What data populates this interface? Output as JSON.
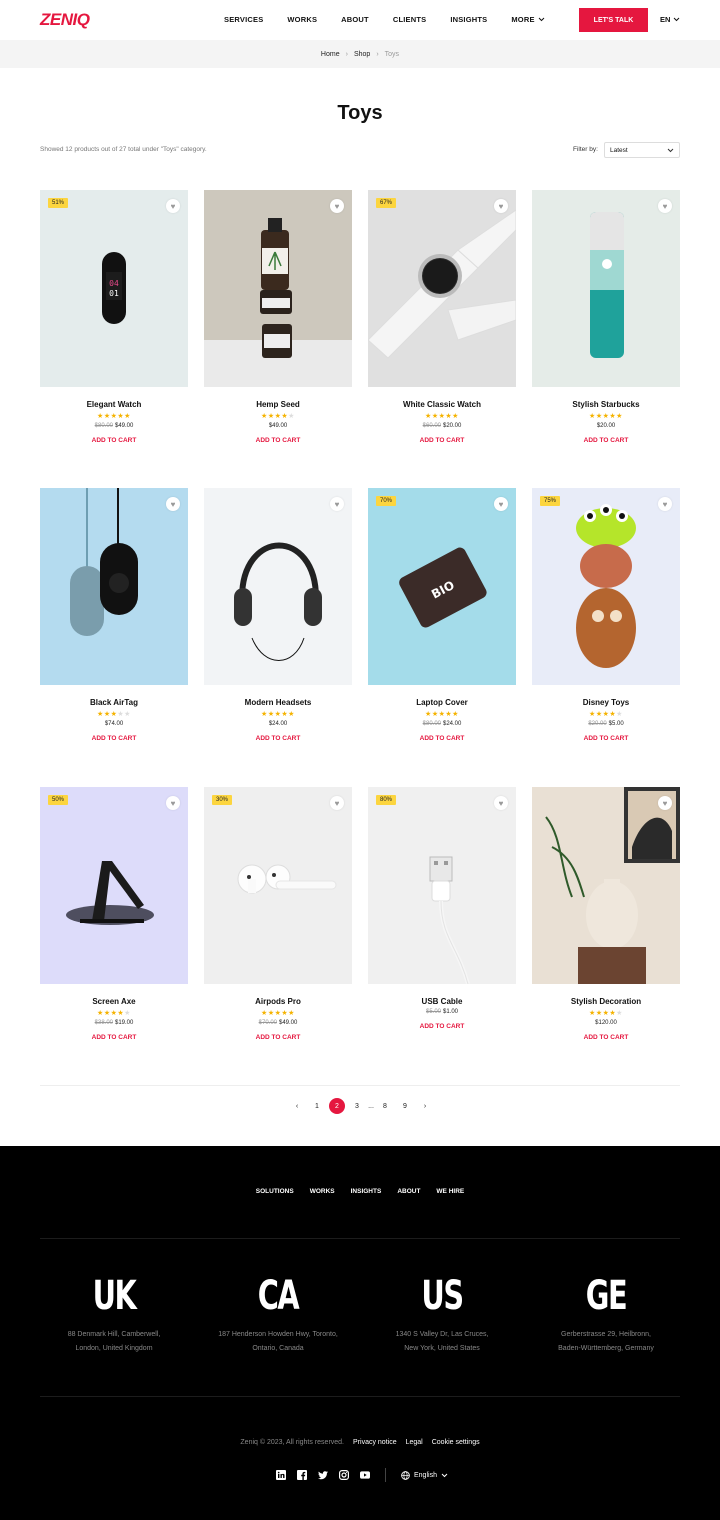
{
  "header": {
    "logo": "ZENIQ",
    "nav": [
      "SERVICES",
      "WORKS",
      "ABOUT",
      "CLIENTS",
      "INSIGHTS"
    ],
    "more": "MORE",
    "cta": "LET'S TALK",
    "lang": "EN"
  },
  "breadcrumb": [
    "Home",
    "Shop",
    "Toys"
  ],
  "page": {
    "title": "Toys",
    "result_text": "Showed 12 products out of 27 total under \"Toys\" category.",
    "filter_label": "Filter by:",
    "filter_value": "Latest"
  },
  "products": [
    {
      "name": "Elegant Watch",
      "rating": 5,
      "old_price": "$80.00",
      "price": "$49.00",
      "badge": "51%",
      "add": "ADD TO CART",
      "bg": "#e4ecec"
    },
    {
      "name": "Hemp Seed",
      "rating": 4,
      "old_price": "",
      "price": "$49.00",
      "badge": "",
      "add": "ADD TO CART",
      "bg": "#cdc8bd"
    },
    {
      "name": "White Classic Watch",
      "rating": 5,
      "old_price": "$60.00",
      "price": "$20.00",
      "badge": "67%",
      "add": "ADD TO CART",
      "bg": "#e0e0e0"
    },
    {
      "name": "Stylish Starbucks",
      "rating": 5,
      "old_price": "",
      "price": "$20.00",
      "badge": "",
      "add": "ADD TO CART",
      "bg": "#e5ece8"
    },
    {
      "name": "Black AirTag",
      "rating": 3,
      "old_price": "",
      "price": "$74.00",
      "badge": "",
      "add": "ADD TO CART",
      "bg": "#b4dbef"
    },
    {
      "name": "Modern Headsets",
      "rating": 5,
      "old_price": "",
      "price": "$24.00",
      "badge": "",
      "add": "ADD TO CART",
      "bg": "#f2f4f6"
    },
    {
      "name": "Laptop Cover",
      "rating": 5,
      "old_price": "$80.00",
      "price": "$24.00",
      "badge": "70%",
      "add": "ADD TO CART",
      "bg": "#a4dcea"
    },
    {
      "name": "Disney Toys",
      "rating": 4,
      "old_price": "$20.00",
      "price": "$5.00",
      "badge": "75%",
      "add": "ADD TO CART",
      "bg": "#e8ecf8"
    },
    {
      "name": "Screen Axe",
      "rating": 4,
      "old_price": "$38.00",
      "price": "$19.00",
      "badge": "50%",
      "add": "ADD TO CART",
      "bg": "#dddcfa"
    },
    {
      "name": "Airpods Pro",
      "rating": 5,
      "old_price": "$70.00",
      "price": "$49.00",
      "badge": "30%",
      "add": "ADD TO CART",
      "bg": "#efefef"
    },
    {
      "name": "USB Cable",
      "rating": 0,
      "old_price": "$5.00",
      "price": "$1.00",
      "badge": "80%",
      "add": "ADD TO CART",
      "bg": "#f0f0f0"
    },
    {
      "name": "Stylish Decoration",
      "rating": 4,
      "old_price": "",
      "price": "$120.00",
      "badge": "",
      "add": "ADD TO CART",
      "bg": "#e9e0d4"
    }
  ],
  "pagination": {
    "pages": [
      "1",
      "2",
      "3",
      "...",
      "8",
      "9"
    ],
    "active": "2"
  },
  "footer": {
    "nav": [
      "SOLUTIONS",
      "WORKS",
      "INSIGHTS",
      "ABOUT",
      "WE HIRE"
    ],
    "offices": [
      {
        "code": "UK",
        "line1": "88 Denmark Hill, Camberwell,",
        "line2": "London, United Kingdom"
      },
      {
        "code": "CA",
        "line1": "187 Henderson Howden Hwy, Toronto,",
        "line2": "Ontario, Canada"
      },
      {
        "code": "US",
        "line1": "1340 S Valley Dr, Las Cruces,",
        "line2": "New York, United States"
      },
      {
        "code": "GE",
        "line1": "Gerberstrasse 29, Heilbronn,",
        "line2": "Baden-Württemberg, Germany"
      }
    ],
    "copyright": "Zeniq © 2023, All rights reserved.",
    "links": [
      "Privacy notice",
      "Legal",
      "Cookie settings"
    ],
    "lang": "English",
    "socials": [
      "linkedin-icon",
      "facebook-icon",
      "twitter-icon",
      "instagram-icon",
      "youtube-icon"
    ]
  },
  "colors": {
    "accent": "#e5173f",
    "badge": "#fcd53f",
    "star": "#f5b301",
    "footer_bg": "#000000"
  }
}
